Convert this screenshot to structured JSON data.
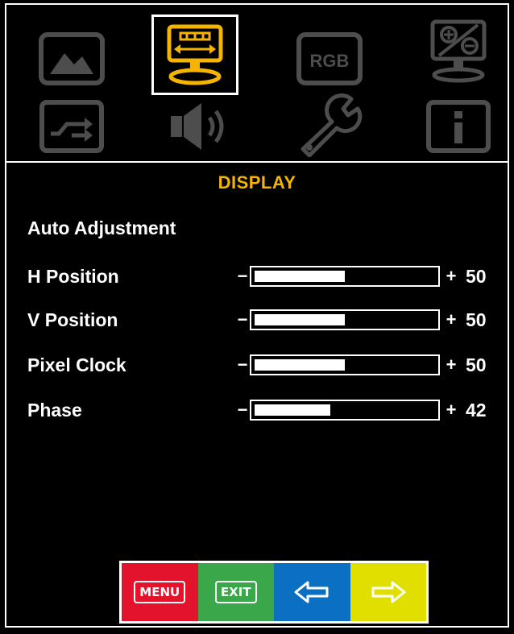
{
  "menu": {
    "icons": [
      "picture-icon",
      "display-icon",
      "rgb-icon",
      "color-temp-icon",
      "input-source-icon",
      "audio-icon",
      "setup-icon",
      "info-icon"
    ],
    "selected": "display-icon",
    "rgb_text": "RGB"
  },
  "section": {
    "title": "DISPLAY",
    "auto_adjustment": "Auto Adjustment"
  },
  "settings": [
    {
      "label": "H Position",
      "minus": "−",
      "plus": "+",
      "value": "50",
      "level": 0.5
    },
    {
      "label": "V Position",
      "minus": "−",
      "plus": "+",
      "value": "50",
      "level": 0.5
    },
    {
      "label": "Pixel Clock",
      "minus": "−",
      "plus": "+",
      "value": "50",
      "level": 0.5
    },
    {
      "label": "Phase",
      "minus": "−",
      "plus": "+",
      "value": "42",
      "level": 0.42
    }
  ],
  "buttons": {
    "menu_label": "MENU",
    "exit_label": "EXIT",
    "colors": {
      "menu": "#e3132b",
      "exit": "#3aa84a",
      "left": "#0b6fc2",
      "right": "#e0df00"
    }
  },
  "colors": {
    "accent": "#f5b400",
    "icon_gray": "#4d4d4d"
  }
}
